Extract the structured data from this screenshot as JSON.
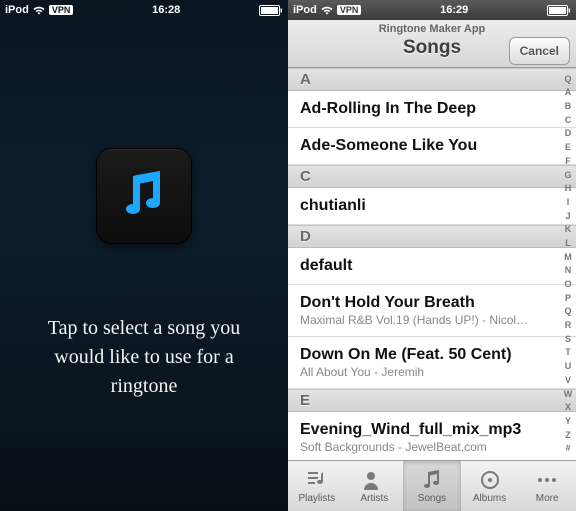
{
  "left": {
    "status": {
      "carrier": "iPod",
      "vpn": "VPN",
      "time": "16:28"
    },
    "instruction": "Tap to select a song you would like to use for a ringtone"
  },
  "right": {
    "status": {
      "carrier": "iPod",
      "vpn": "VPN",
      "time": "16:29"
    },
    "header": {
      "app": "Ringtone Maker App",
      "title": "Songs",
      "cancel": "Cancel"
    },
    "sections": [
      {
        "letter": "A",
        "rows": [
          {
            "title": "Ad-Rolling In The Deep",
            "sub": ""
          },
          {
            "title": "Ade-Someone Like You",
            "sub": ""
          }
        ]
      },
      {
        "letter": "C",
        "rows": [
          {
            "title": "chutianli",
            "sub": ""
          }
        ]
      },
      {
        "letter": "D",
        "rows": [
          {
            "title": "default",
            "sub": ""
          },
          {
            "title": "Don't Hold Your Breath",
            "sub": "Maximal R&B Vol.19 (Hands UP!) - Nicol…"
          },
          {
            "title": "Down On Me (Feat. 50 Cent)",
            "sub": "All About You  - Jeremih"
          }
        ]
      },
      {
        "letter": "E",
        "rows": [
          {
            "title": "Evening_Wind_full_mix_mp3",
            "sub": "Soft Backgrounds - JewelBeat.com"
          }
        ]
      }
    ],
    "index": [
      "Q",
      "A",
      "B",
      "C",
      "D",
      "E",
      "F",
      "G",
      "H",
      "I",
      "J",
      "K",
      "L",
      "M",
      "N",
      "O",
      "P",
      "Q",
      "R",
      "S",
      "T",
      "U",
      "V",
      "W",
      "X",
      "Y",
      "Z",
      "#"
    ],
    "tabs": [
      {
        "label": "Playlists",
        "active": false
      },
      {
        "label": "Artists",
        "active": false
      },
      {
        "label": "Songs",
        "active": true
      },
      {
        "label": "Albums",
        "active": false
      },
      {
        "label": "More",
        "active": false
      }
    ]
  }
}
